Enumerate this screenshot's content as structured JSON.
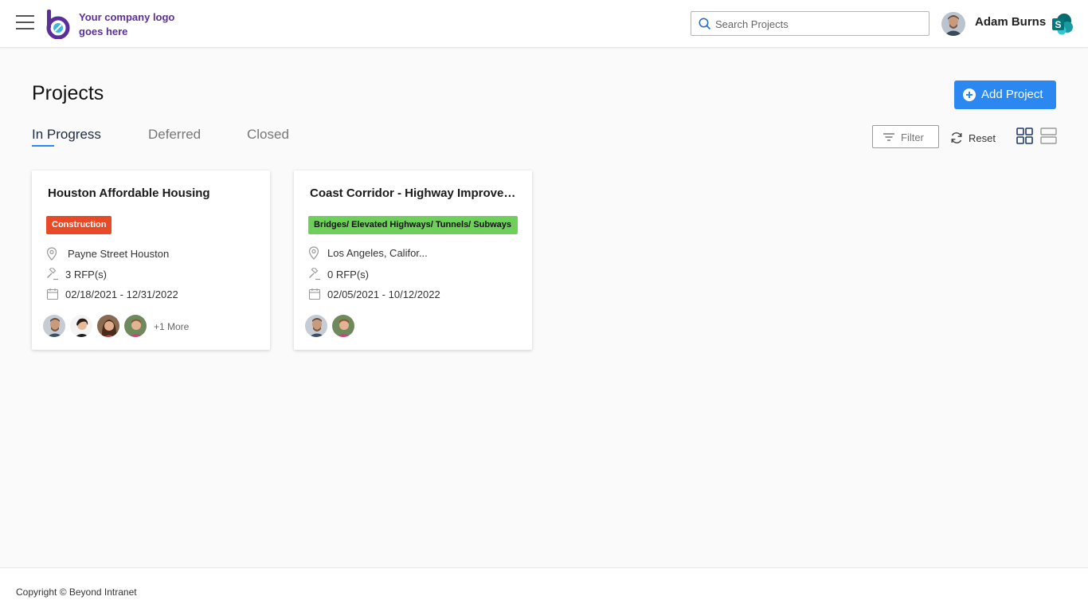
{
  "header": {
    "logo_text": "Your company logo goes here",
    "search_placeholder": "Search Projects",
    "user_name": "Adam Burns",
    "sp_letter": "S"
  },
  "page": {
    "title": "Projects",
    "add_button": "Add Project"
  },
  "tabs": [
    {
      "label": "In Progress",
      "active": true
    },
    {
      "label": "Deferred",
      "active": false
    },
    {
      "label": "Closed",
      "active": false
    }
  ],
  "toolbar": {
    "filter_label": "Filter",
    "reset_label": "Reset"
  },
  "projects": [
    {
      "title": "Houston Affordable Housing",
      "category": "Construction",
      "category_bg": "#e84a27",
      "category_fg": "#ffffff",
      "location": "Payne Street Houston",
      "rfps": "3 RFP(s)",
      "dates": "02/18/2021 - 12/31/2022",
      "more": "+1 More"
    },
    {
      "title": "Coast Corridor - Highway Improvement",
      "category": "Bridges/ Elevated Highways/ Tunnels/ Subways",
      "category_bg": "#6fcf5b",
      "category_fg": "#111111",
      "location": "Los Angeles, Califor...",
      "rfps": "0 RFP(s)",
      "dates": "02/05/2021 - 10/12/2022"
    }
  ],
  "footer": {
    "copyright": "Copyright © Beyond Intranet"
  },
  "colors": {
    "accent": "#2b88f0",
    "brand": "#5b2e9c",
    "construction": "#e84a27",
    "bridges": "#6fcf5b"
  },
  "icons": [
    "menu-icon",
    "logo-icon",
    "search-icon",
    "sharepoint-icon",
    "plus-circle-icon",
    "filter-icon",
    "refresh-icon",
    "grid-view-icon",
    "list-view-icon",
    "location-pin-icon",
    "gavel-icon",
    "calendar-icon"
  ]
}
